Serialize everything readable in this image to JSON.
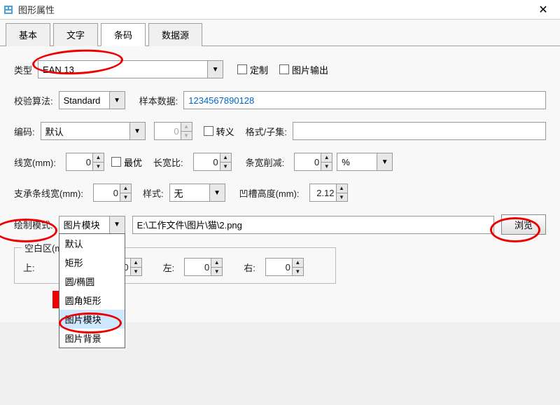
{
  "window": {
    "title": "图形属性"
  },
  "tabs": {
    "t0": "基本",
    "t1": "文字",
    "t2": "条码",
    "t3": "数据源"
  },
  "r1": {
    "type_label": "类型",
    "type_value": "EAN 13",
    "custom": "定制",
    "img_out": "图片输出"
  },
  "r2": {
    "algo_label": "校验算法:",
    "algo_value": "Standard",
    "sample_label": "样本数据:",
    "sample_value": "1234567890128"
  },
  "r3": {
    "enc_label": "编码:",
    "enc_value": "默认",
    "sp1": "0",
    "esc": "转义",
    "fmt_label": "格式/子集:",
    "fmt_value": ""
  },
  "r4": {
    "lw_label": "线宽(mm):",
    "lw": "0",
    "best": "最优",
    "ratio_label": "长宽比:",
    "ratio": "0",
    "reduce_label": "条宽削减:",
    "reduce": "0",
    "unit": "%"
  },
  "r5": {
    "bw_label": "支承条线宽(mm):",
    "bw": "0",
    "style_label": "样式:",
    "style_value": "无",
    "notch_label": "凹槽高度(mm):",
    "notch": "2.12"
  },
  "r6": {
    "mode_label": "绘制模式:",
    "mode_value": "图片模块",
    "path": "E:\\工作文件\\图片\\猫\\2.png",
    "browse": "浏览"
  },
  "dropdown": [
    "默认",
    "矩形",
    "圆/椭圆",
    "圆角矩形",
    "图片模块",
    "图片背景"
  ],
  "margin": {
    "legend": "空白区(mm)",
    "top_label": "上:",
    "top": "0",
    "left_label": "左:",
    "left": "0",
    "right_label": "右:",
    "right": "0"
  }
}
